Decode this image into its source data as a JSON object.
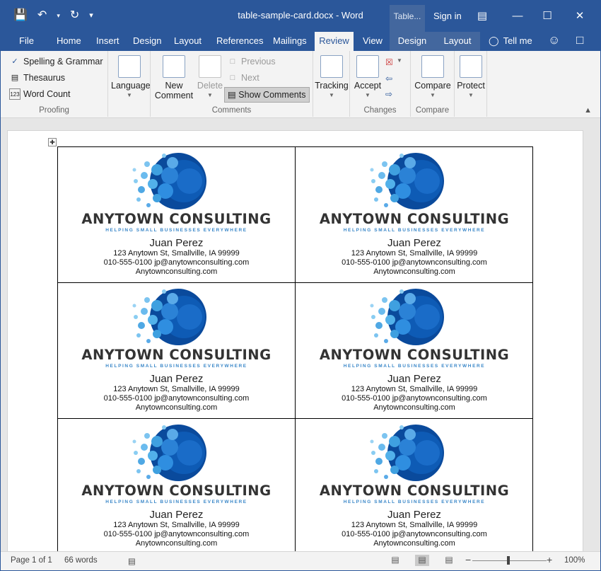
{
  "window": {
    "title": "table-sample-card.docx - Word",
    "table_tools": "Table...",
    "sign_in": "Sign in"
  },
  "qat": {
    "save_icon": "save-icon",
    "undo_icon": "undo-icon",
    "redo_icon": "redo-icon",
    "customize_icon": "customize-qat-icon"
  },
  "tabs": [
    {
      "label": "File"
    },
    {
      "label": "Home"
    },
    {
      "label": "Insert"
    },
    {
      "label": "Design"
    },
    {
      "label": "Layout"
    },
    {
      "label": "References"
    },
    {
      "label": "Mailings"
    },
    {
      "label": "Review",
      "active": true
    },
    {
      "label": "View"
    },
    {
      "label": "Design"
    },
    {
      "label": "Layout"
    }
  ],
  "tell_me": "Tell me",
  "ribbon": {
    "proofing": {
      "spelling": "Spelling & Grammar",
      "thesaurus": "Thesaurus",
      "word_count": "Word Count",
      "label": "Proofing"
    },
    "language": {
      "label": "Language"
    },
    "comments": {
      "new_comment_1": "New",
      "new_comment_2": "Comment",
      "delete": "Delete",
      "previous": "Previous",
      "next": "Next",
      "show_comments": "Show Comments",
      "label": "Comments"
    },
    "tracking": {
      "label": "Tracking"
    },
    "changes": {
      "accept": "Accept",
      "label": "Changes"
    },
    "compare": {
      "compare": "Compare",
      "label": "Compare"
    },
    "protect": {
      "protect": "Protect"
    }
  },
  "card": {
    "company": "ANYTOWN CONSULTING",
    "tagline": "HELPING SMALL BUSINESSES EVERYWHERE",
    "name": "Juan Perez",
    "address": "123 Anytown St, Smallville, IA 99999",
    "contact": "010-555-0100  jp@anytownconsulting.com",
    "website": "Anytownconsulting.com"
  },
  "status": {
    "page": "Page 1 of 1",
    "words": "66 words",
    "zoom": "100%"
  },
  "colors": {
    "word_blue": "#2b579a",
    "logo_dark": "#0a4a9c",
    "logo_light": "#3fa0e0",
    "tagline": "#3a87c8"
  }
}
